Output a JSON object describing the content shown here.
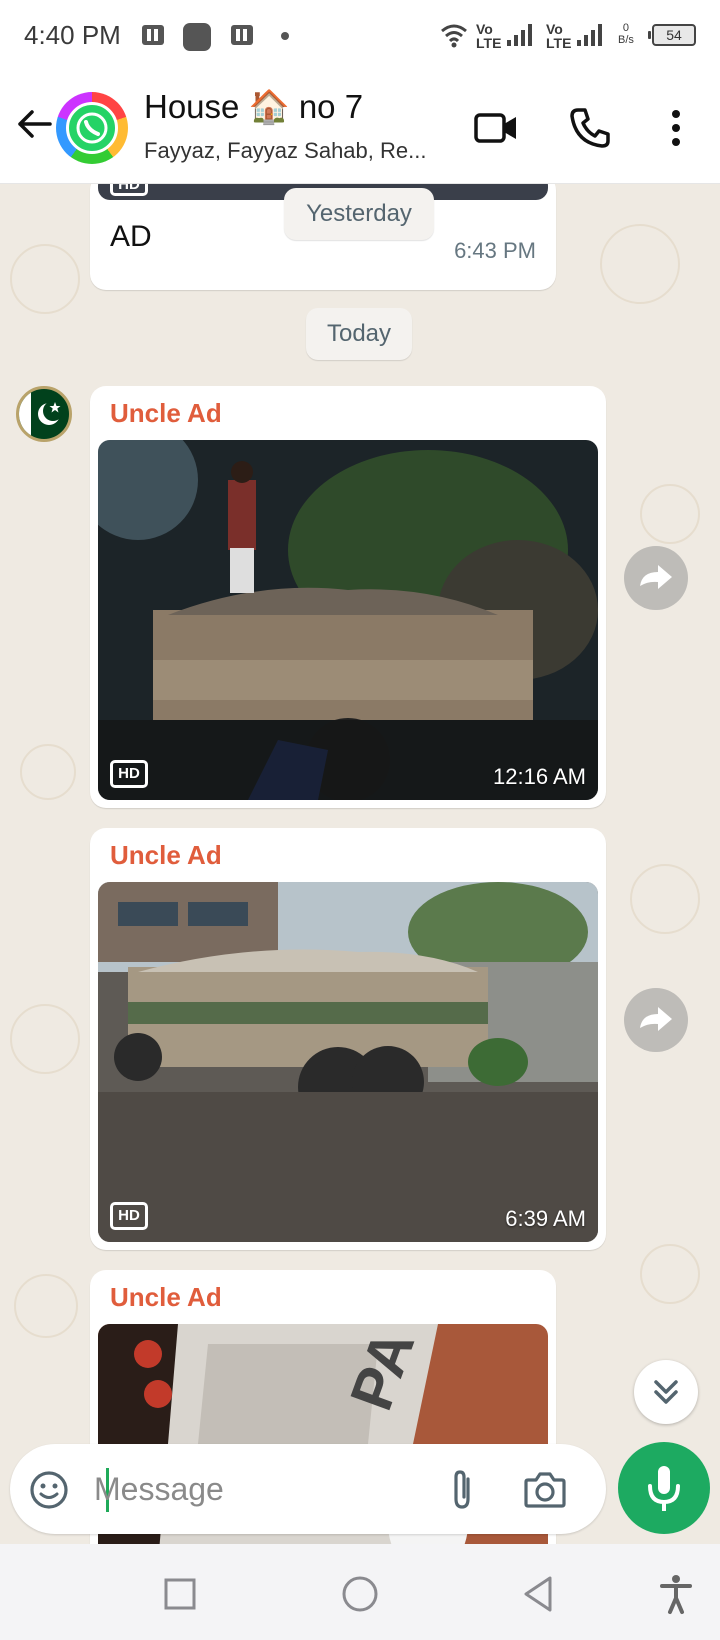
{
  "status_bar": {
    "time": "4:40 PM",
    "net1": "Vo\nLTE",
    "net2": "Vo\nLTE",
    "speed_value": "0",
    "speed_unit": "B/s",
    "battery": "54",
    "icons": [
      "status-app-icon",
      "status-app-icon",
      "status-app-icon",
      "dot-icon",
      "wifi-icon",
      "signal-icon",
      "signal-icon",
      "battery-icon"
    ]
  },
  "header": {
    "title": "House 🏠 no 7",
    "subtitle": "Fayyaz, Fayyaz Sahab, Re...",
    "icons": [
      "back-arrow-icon",
      "video-call-icon",
      "phone-icon",
      "more-vertical-icon"
    ]
  },
  "chat": {
    "previous_message": {
      "text": "AD",
      "time": "6:43 PM"
    },
    "date_chips": [
      "Yesterday",
      "Today"
    ],
    "messages": [
      {
        "sender": "Uncle Ad",
        "badge": "HD",
        "time": "12:16 AM"
      },
      {
        "sender": "Uncle Ad",
        "badge": "HD",
        "time": "6:39 AM"
      },
      {
        "sender": "Uncle Ad"
      }
    ]
  },
  "composer": {
    "placeholder": "Message",
    "icons": [
      "emoji-icon",
      "attach-icon",
      "camera-icon",
      "mic-icon"
    ]
  },
  "nav_bar": {
    "icons": [
      "recents-icon",
      "home-icon",
      "back-icon",
      "accessibility-icon"
    ]
  },
  "colors": {
    "accent_green": "#1daa61",
    "sender_name": "#e05d3c",
    "chat_background": "#efeae2"
  }
}
